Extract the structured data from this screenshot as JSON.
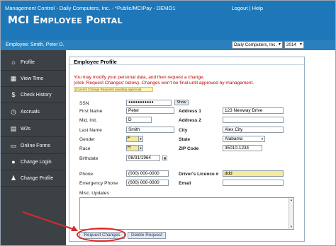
{
  "header": {
    "app_path": "Management Control - Daily Computers, Inc. - *Public/MCIPay - DEMO1",
    "logout": "Logout",
    "sep": "|",
    "help": "Help",
    "title_big1": "MCI E",
    "title_small1": "MPLOYEE",
    "title_big2": " P",
    "title_small2": "ORTAL"
  },
  "subbar": {
    "employee": "Employee: Smith, Peter D.",
    "company": "Daily Computers, Inc.",
    "year": "2014"
  },
  "sidebar": {
    "items": [
      {
        "label": "Profile",
        "icon": "house-icon"
      },
      {
        "label": "View Time",
        "icon": "calendar-icon"
      },
      {
        "label": "Check History",
        "icon": "money-bag-icon"
      },
      {
        "label": "Accruals",
        "icon": "clock-icon"
      },
      {
        "label": "W2s",
        "icon": "document-icon"
      },
      {
        "label": "Online Forms",
        "icon": "form-icon"
      },
      {
        "label": "Change Login",
        "icon": "person-icon"
      },
      {
        "label": "Change Profile",
        "icon": "people-icon"
      }
    ]
  },
  "profile": {
    "title": "Employee Profile",
    "note1": "You may modify your personal data, and then request a change.",
    "note2": "(click 'Request Changes' below). Changes won't be final until approved by management.",
    "pending": "(Current Change Requests awaiting approval)",
    "fields": {
      "ssn_label": "SSN",
      "ssn_value": "●●●●●●●●●●●",
      "show_label": "Show",
      "first_label": "First Name",
      "first_value": "Peter",
      "mid_label": "Mid. Init.",
      "mid_value": "D",
      "last_label": "Last Name",
      "last_value": "Smith",
      "gender_label": "Gender",
      "gender_value": "F",
      "race_label": "Race",
      "race_value": "H",
      "birth_label": "Birthdate",
      "birth_value": "08/31/1964",
      "addr1_label": "Address 1",
      "addr1_value": "123 Newway Drive",
      "addr2_label": "Address 2",
      "addr2_value": "",
      "city_label": "City",
      "city_value": "Alex City",
      "state_label": "State",
      "state_value": "Alabama",
      "zip_label": "ZIP Code",
      "zip_value": "35010-1234",
      "phone_label": "Phone",
      "phone_value": "(000) 000-0000",
      "emerg_label": "Emergency Phone",
      "emerg_value": "(000) 000-0000",
      "dl_label": "Driver's Licence #",
      "dl_value": "ddd",
      "email_label": "Email",
      "email_value": "",
      "misc_label": "Misc. Updates"
    },
    "buttons": {
      "request": "Request Changes",
      "delete": "Delete Request"
    }
  },
  "colors": {
    "header_blue": "#1e77b8",
    "sidebar_dark": "#3c4146",
    "note_red": "#c00000",
    "highlight_yellow": "#f4ea9e",
    "annotation_red": "#d62a2a"
  }
}
